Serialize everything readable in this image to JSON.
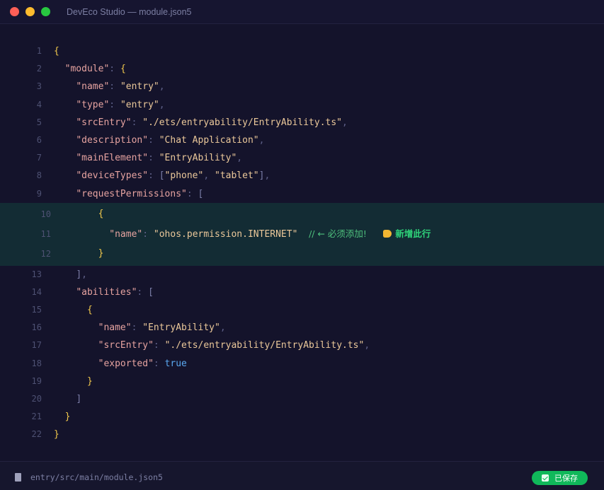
{
  "window": {
    "title": "DevEco Studio — module.json5"
  },
  "editor": {
    "lines": [
      {
        "n": "1",
        "tokens": [
          {
            "t": "{",
            "c": "brace"
          }
        ]
      },
      {
        "n": "2",
        "tokens": [
          {
            "t": "  ",
            "c": ""
          },
          {
            "t": "\"module\"",
            "c": "key"
          },
          {
            "t": ": ",
            "c": "punct"
          },
          {
            "t": "{",
            "c": "brace"
          }
        ]
      },
      {
        "n": "3",
        "tokens": [
          {
            "t": "    ",
            "c": ""
          },
          {
            "t": "\"name\"",
            "c": "key"
          },
          {
            "t": ": ",
            "c": "punct"
          },
          {
            "t": "\"entry\"",
            "c": "str"
          },
          {
            "t": ",",
            "c": "punct"
          }
        ]
      },
      {
        "n": "4",
        "tokens": [
          {
            "t": "    ",
            "c": ""
          },
          {
            "t": "\"type\"",
            "c": "key"
          },
          {
            "t": ": ",
            "c": "punct"
          },
          {
            "t": "\"entry\"",
            "c": "str"
          },
          {
            "t": ",",
            "c": "punct"
          }
        ]
      },
      {
        "n": "5",
        "tokens": [
          {
            "t": "    ",
            "c": ""
          },
          {
            "t": "\"srcEntry\"",
            "c": "key"
          },
          {
            "t": ": ",
            "c": "punct"
          },
          {
            "t": "\"./ets/entryability/EntryAbility.ts\"",
            "c": "str"
          },
          {
            "t": ",",
            "c": "punct"
          }
        ]
      },
      {
        "n": "6",
        "tokens": [
          {
            "t": "    ",
            "c": ""
          },
          {
            "t": "\"description\"",
            "c": "key"
          },
          {
            "t": ": ",
            "c": "punct"
          },
          {
            "t": "\"Chat Application\"",
            "c": "str"
          },
          {
            "t": ",",
            "c": "punct"
          }
        ]
      },
      {
        "n": "7",
        "tokens": [
          {
            "t": "    ",
            "c": ""
          },
          {
            "t": "\"mainElement\"",
            "c": "key"
          },
          {
            "t": ": ",
            "c": "punct"
          },
          {
            "t": "\"EntryAbility\"",
            "c": "str"
          },
          {
            "t": ",",
            "c": "punct"
          }
        ]
      },
      {
        "n": "8",
        "tokens": [
          {
            "t": "    ",
            "c": ""
          },
          {
            "t": "\"deviceTypes\"",
            "c": "key"
          },
          {
            "t": ": ",
            "c": "punct"
          },
          {
            "t": "[",
            "c": "bracket"
          },
          {
            "t": "\"phone\"",
            "c": "str"
          },
          {
            "t": ", ",
            "c": "punct"
          },
          {
            "t": "\"tablet\"",
            "c": "str"
          },
          {
            "t": "]",
            "c": "bracket"
          },
          {
            "t": ",",
            "c": "punct"
          }
        ]
      },
      {
        "n": "9",
        "tokens": [
          {
            "t": "    ",
            "c": ""
          },
          {
            "t": "\"requestPermissions\"",
            "c": "key"
          },
          {
            "t": ": ",
            "c": "punct"
          },
          {
            "t": "[",
            "c": "bracket"
          }
        ]
      }
    ],
    "highlighted_lines": [
      {
        "n": "10",
        "tokens": [
          {
            "t": "        ",
            "c": ""
          },
          {
            "t": "{",
            "c": "brace"
          }
        ]
      },
      {
        "n": "11",
        "tokens": [
          {
            "t": "          ",
            "c": ""
          },
          {
            "t": "\"name\"",
            "c": "key"
          },
          {
            "t": ": ",
            "c": "punct"
          },
          {
            "t": "\"ohos.permission.INTERNET\"",
            "c": "str"
          },
          {
            "t": "  ",
            "c": ""
          },
          {
            "t": "// ← 必须添加!",
            "c": "comment"
          }
        ],
        "tag": "新增此行"
      },
      {
        "n": "12",
        "tokens": [
          {
            "t": "        ",
            "c": ""
          },
          {
            "t": "}",
            "c": "brace"
          }
        ]
      }
    ],
    "lines_after": [
      {
        "n": "13",
        "tokens": [
          {
            "t": "    ",
            "c": ""
          },
          {
            "t": "]",
            "c": "bracket"
          },
          {
            "t": ",",
            "c": "punct"
          }
        ]
      },
      {
        "n": "14",
        "tokens": [
          {
            "t": "    ",
            "c": ""
          },
          {
            "t": "\"abilities\"",
            "c": "key"
          },
          {
            "t": ": ",
            "c": "punct"
          },
          {
            "t": "[",
            "c": "bracket"
          }
        ]
      },
      {
        "n": "15",
        "tokens": [
          {
            "t": "      ",
            "c": ""
          },
          {
            "t": "{",
            "c": "brace"
          }
        ]
      },
      {
        "n": "16",
        "tokens": [
          {
            "t": "        ",
            "c": ""
          },
          {
            "t": "\"name\"",
            "c": "key"
          },
          {
            "t": ": ",
            "c": "punct"
          },
          {
            "t": "\"EntryAbility\"",
            "c": "str"
          },
          {
            "t": ",",
            "c": "punct"
          }
        ]
      },
      {
        "n": "17",
        "tokens": [
          {
            "t": "        ",
            "c": ""
          },
          {
            "t": "\"srcEntry\"",
            "c": "key"
          },
          {
            "t": ": ",
            "c": "punct"
          },
          {
            "t": "\"./ets/entryability/EntryAbility.ts\"",
            "c": "str"
          },
          {
            "t": ",",
            "c": "punct"
          }
        ]
      },
      {
        "n": "18",
        "tokens": [
          {
            "t": "        ",
            "c": ""
          },
          {
            "t": "\"exported\"",
            "c": "key"
          },
          {
            "t": ": ",
            "c": "punct"
          },
          {
            "t": "true",
            "c": "bool"
          }
        ]
      },
      {
        "n": "19",
        "tokens": [
          {
            "t": "      ",
            "c": ""
          },
          {
            "t": "}",
            "c": "brace"
          }
        ]
      },
      {
        "n": "20",
        "tokens": [
          {
            "t": "    ",
            "c": ""
          },
          {
            "t": "]",
            "c": "bracket"
          }
        ]
      },
      {
        "n": "21",
        "tokens": [
          {
            "t": "  ",
            "c": ""
          },
          {
            "t": "}",
            "c": "brace"
          }
        ]
      },
      {
        "n": "22",
        "tokens": [
          {
            "t": "}",
            "c": "brace"
          }
        ]
      }
    ]
  },
  "statusbar": {
    "file_icon": "file-icon",
    "file_path": "entry/src/main/module.json5",
    "saved_label": "已保存",
    "saved_icon": "check-icon",
    "saved_color": "#10b85a"
  },
  "colors": {
    "background": "#14132b",
    "highlight": "#132c34",
    "key": "#e6a3a0",
    "string": "#ebc89a",
    "brace": "#f2c94c",
    "bool": "#5aa8f0",
    "comment": "#4ec07d"
  }
}
